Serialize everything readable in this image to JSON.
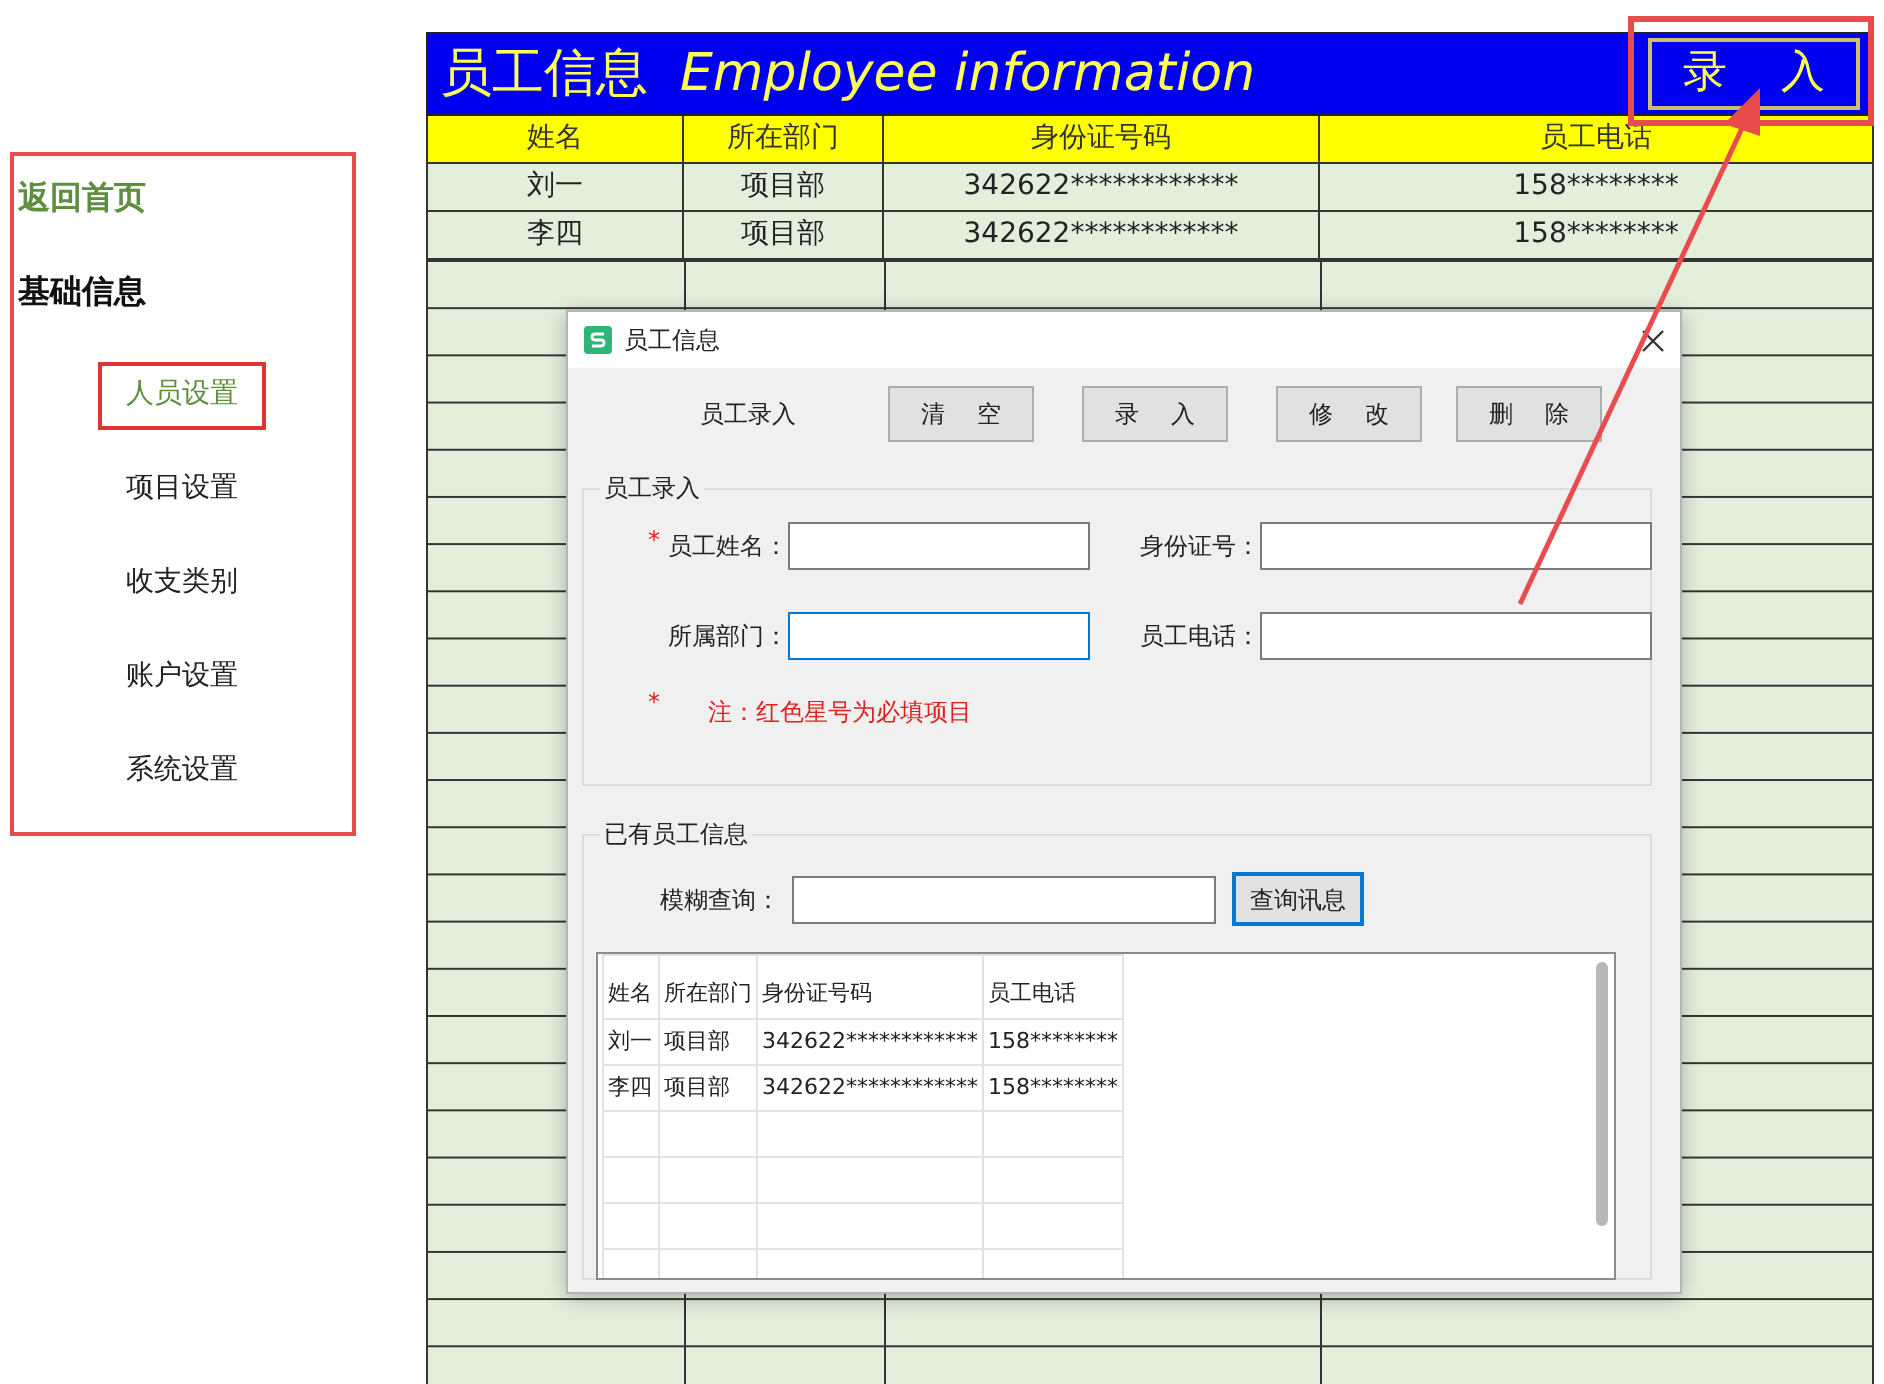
{
  "sidebar": {
    "items": [
      {
        "label": "返回首页",
        "kind": "link"
      },
      {
        "label": "基础信息",
        "kind": "heading"
      },
      {
        "label": "人员设置",
        "kind": "item",
        "selected": true
      },
      {
        "label": "项目设置",
        "kind": "item",
        "selected": false
      },
      {
        "label": "收支类别",
        "kind": "item",
        "selected": false
      },
      {
        "label": "账户设置",
        "kind": "item",
        "selected": false
      },
      {
        "label": "系统设置",
        "kind": "item",
        "selected": false
      }
    ]
  },
  "sheet": {
    "title": "员工信息",
    "subtitle": "Employee information",
    "entry_button": "录 入",
    "columns": [
      "姓名",
      "所在部门",
      "身份证号码",
      "员工电话"
    ],
    "rows": [
      [
        "刘一",
        "项目部",
        "342622************",
        "158********"
      ],
      [
        "李四",
        "项目部",
        "342622************",
        "158********"
      ]
    ]
  },
  "dialog": {
    "title": "员工信息",
    "toolbar_label": "员工录入",
    "buttons": [
      "清 空",
      "录 入",
      "修 改",
      "删 除"
    ],
    "entry_group": {
      "title": "员工录入",
      "fields": [
        {
          "label": "员工姓名：",
          "marker": "*",
          "focused": false
        },
        {
          "label": "身份证号：",
          "focused": false
        },
        {
          "label": "所属部门：",
          "focused": true
        },
        {
          "label": "员工电话：",
          "focused": false
        }
      ],
      "note_marker": "*",
      "note": "注：红色星号为必填项目"
    },
    "list_group": {
      "title": "已有员工信息",
      "search_label": "模糊查询：",
      "search_button": "查询讯息",
      "columns": [
        "姓名",
        "所在部门",
        "身份证号码",
        "员工电话"
      ],
      "rows": [
        [
          "刘一",
          "项目部",
          "342622************",
          "158********"
        ],
        [
          "李四",
          "项目部",
          "342622************",
          "158********"
        ]
      ]
    }
  }
}
